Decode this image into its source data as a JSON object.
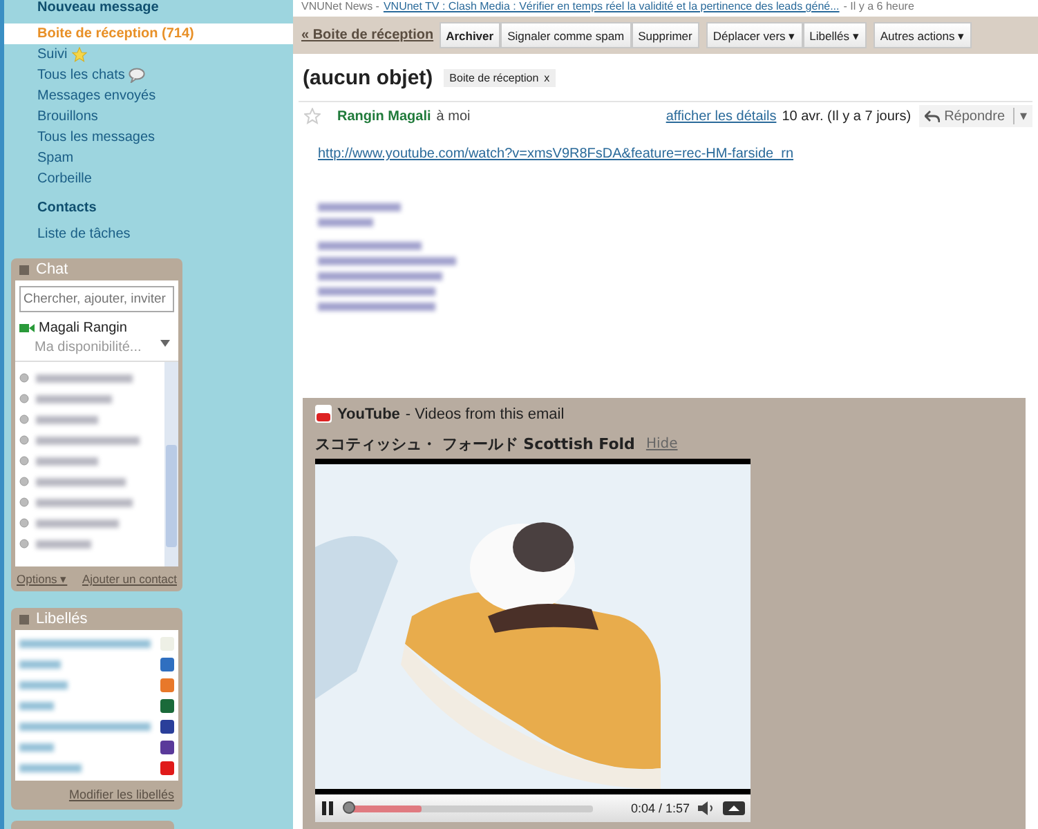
{
  "sidebar": {
    "compose": "Nouveau message",
    "folders": [
      {
        "label": "Boite de réception (714)",
        "selected": true,
        "kind": "plain"
      },
      {
        "label": "Suivi",
        "selected": false,
        "kind": "starred"
      },
      {
        "label": "Tous les chats",
        "selected": false,
        "kind": "chats"
      },
      {
        "label": "Messages envoyés",
        "selected": false,
        "kind": "plain"
      },
      {
        "label": "Brouillons",
        "selected": false,
        "kind": "plain"
      },
      {
        "label": "Tous les messages",
        "selected": false,
        "kind": "plain"
      },
      {
        "label": "Spam",
        "selected": false,
        "kind": "plain"
      },
      {
        "label": "Corbeille",
        "selected": false,
        "kind": "plain"
      }
    ],
    "contacts": "Contacts",
    "tasks": "Liste de tâches",
    "chat": {
      "title": "Chat",
      "search_placeholder": "Chercher, ajouter, inviter",
      "user": "Magali Rangin",
      "availability": "Ma disponibilité...",
      "options": "Options ▾",
      "add_contact": "Ajouter un contact"
    },
    "labels": {
      "title": "Libellés",
      "items": [
        {
          "color": "#eef0e6"
        },
        {
          "color": "#2f6fc0"
        },
        {
          "color": "#e8782a"
        },
        {
          "color": "#1a6a3a"
        },
        {
          "color": "#2a3f9a"
        },
        {
          "color": "#5a3a9a"
        },
        {
          "color": "#e01a1a"
        }
      ],
      "edit": "Modifier les libellés"
    }
  },
  "main": {
    "news": {
      "source": "VNUNet News -",
      "link": "VNUnet TV : Clash Media : Vérifier en temps réel la validité et la pertinence des leads géné...",
      "time": "- Il y a 6 heure"
    },
    "back": "« Boite de réception",
    "toolbar": [
      {
        "label": "Archiver",
        "bold": true
      },
      {
        "label": "Signaler comme spam",
        "bold": false
      },
      {
        "label": "Supprimer",
        "bold": false
      },
      {
        "label": "Déplacer vers ▾",
        "bold": false
      },
      {
        "label": "Libellés ▾",
        "bold": false
      },
      {
        "label": "Autres actions ▾",
        "bold": false
      }
    ],
    "subject": "(aucun objet)",
    "tag": "Boite de réception",
    "tag_close": "x",
    "sender": "Rangin Magali",
    "to": "à moi",
    "details": "afficher les détails",
    "date": "10 avr. (Il y a 7 jours)",
    "reply": "Répondre",
    "reply_menu": "▾",
    "starred": false,
    "body_link": "http://www.youtube.com/watch?v=xmsV9R8FsDA&feature=rec-HM-farside_rn",
    "youtube": {
      "brand": "YouTube",
      "subtitle": "- Videos from this email",
      "video_title": "スコティッシュ・ フォールド Scottish Fold",
      "hide": "Hide",
      "time": "0:04 / 1:57",
      "level": 0.3,
      "playing": true
    }
  }
}
